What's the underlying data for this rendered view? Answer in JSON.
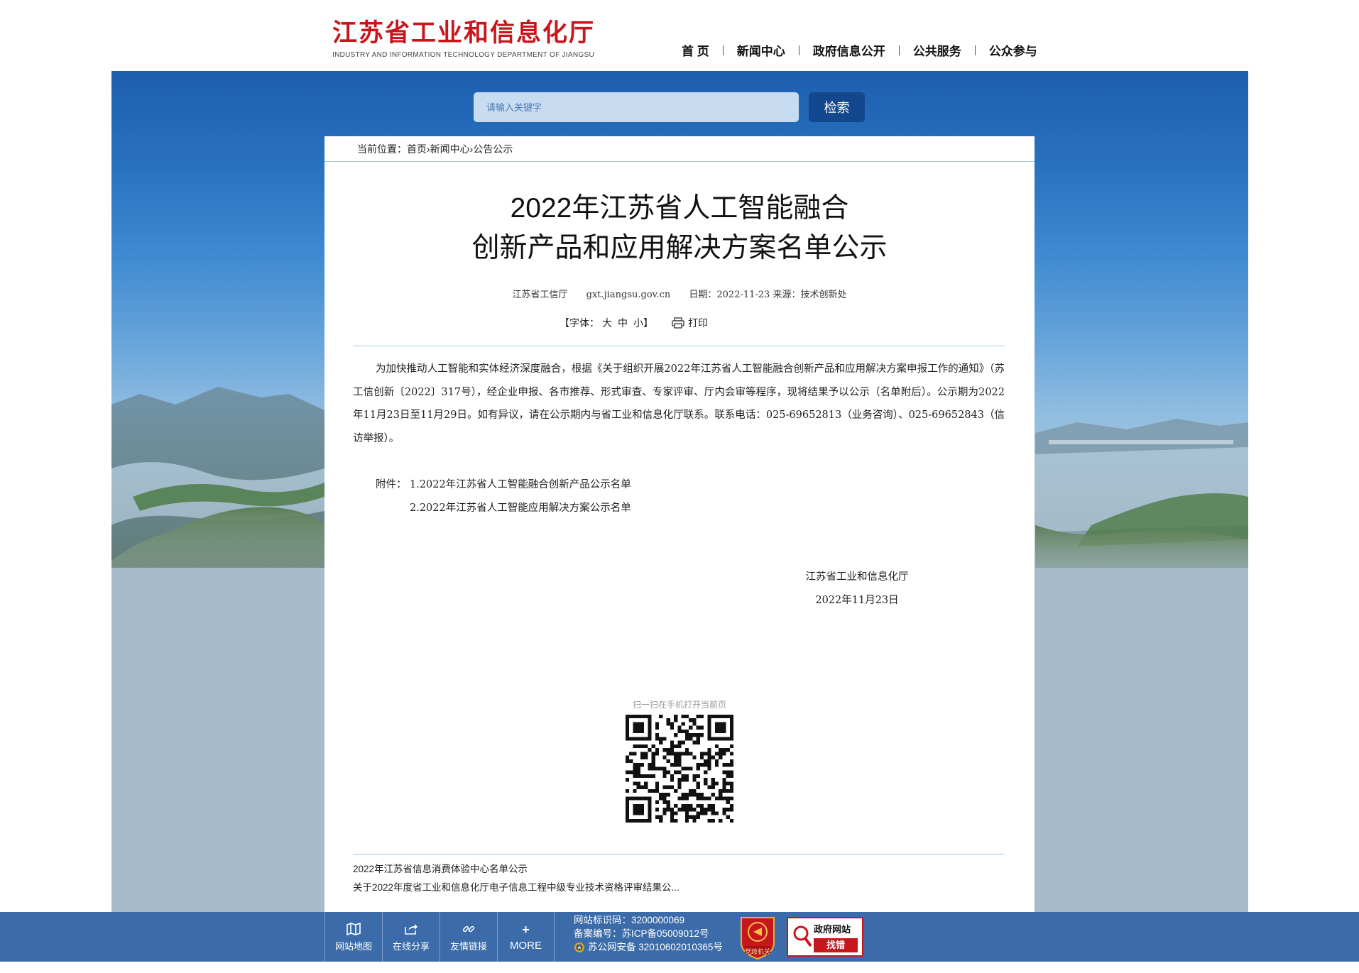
{
  "site": {
    "logo_title": "江苏省工业和信息化厅",
    "logo_subtitle": "INDUSTRY AND INFORMATION TECHNOLOGY DEPARTMENT OF JIANGSU",
    "brand_color": "#c8161d"
  },
  "nav": {
    "items": [
      {
        "label": "首 页"
      },
      {
        "label": "新闻中心"
      },
      {
        "label": "政府信息公开"
      },
      {
        "label": "公共服务"
      },
      {
        "label": "公众参与"
      }
    ]
  },
  "search": {
    "placeholder": "请输入关键字",
    "value": "",
    "button_label": "检索"
  },
  "breadcrumb": {
    "prefix": "当前位置：",
    "items": [
      "首页",
      "新闻中心",
      "公告公示"
    ],
    "separator": "›"
  },
  "article": {
    "title_line1": "2022年江苏省人工智能融合",
    "title_line2": "创新产品和应用解决方案名单公示",
    "publisher": "江苏省工信厅",
    "domain": "gxt.jiangsu.gov.cn",
    "date": "日期：2022-11-23 来源：技术创新处",
    "font_label": "【字体：",
    "font_large": "大",
    "font_medium": "中",
    "font_small": "小】",
    "print_label": "打印",
    "body": "为加快推动人工智能和实体经济深度融合，根据《关于组织开展2022年江苏省人工智能融合创新产品和应用解决方案申报工作的通知》（苏工信创新〔2022〕317号），经企业申报、各市推荐、形式审查、专家评审、厅内会审等程序，现将结果予以公示（名单附后）。公示期为2022年11月23日至11月29日。如有异议，请在公示期内与省工业和信息化厅联系。联系电话：025-69652813（业务咨询）、025-69652843（信访举报）。",
    "attachments_label": "附件：",
    "attachments": [
      "1.2022年江苏省人工智能融合创新产品公示名单",
      "2.2022年江苏省人工智能应用解决方案公示名单"
    ],
    "signature": "江苏省工业和信息化厅",
    "signature_date": "2022年11月23日",
    "qr_label": "扫一扫在手机打开当前页"
  },
  "related": [
    "2022年江苏省信息消费体验中心名单公示",
    "关于2022年度省工业和信息化厅电子信息工程中级专业技术资格评审结果公..."
  ],
  "footer": {
    "buttons": [
      {
        "label": "网站地图",
        "icon": "map-icon"
      },
      {
        "label": "在线分享",
        "icon": "share-icon"
      },
      {
        "label": "友情链接",
        "icon": "link-icon"
      },
      {
        "label": "MORE",
        "icon": "plus-icon"
      }
    ],
    "site_id": "网站标识码：3200000069",
    "icp": "备案编号：苏ICP备05009012号",
    "police": "苏公网安备 32010602010365号",
    "badge_text": "党政机关",
    "jiucuo_top": "政府网站",
    "jiucuo_bottom": "找错",
    "bar_color": "#3b6ba8"
  }
}
